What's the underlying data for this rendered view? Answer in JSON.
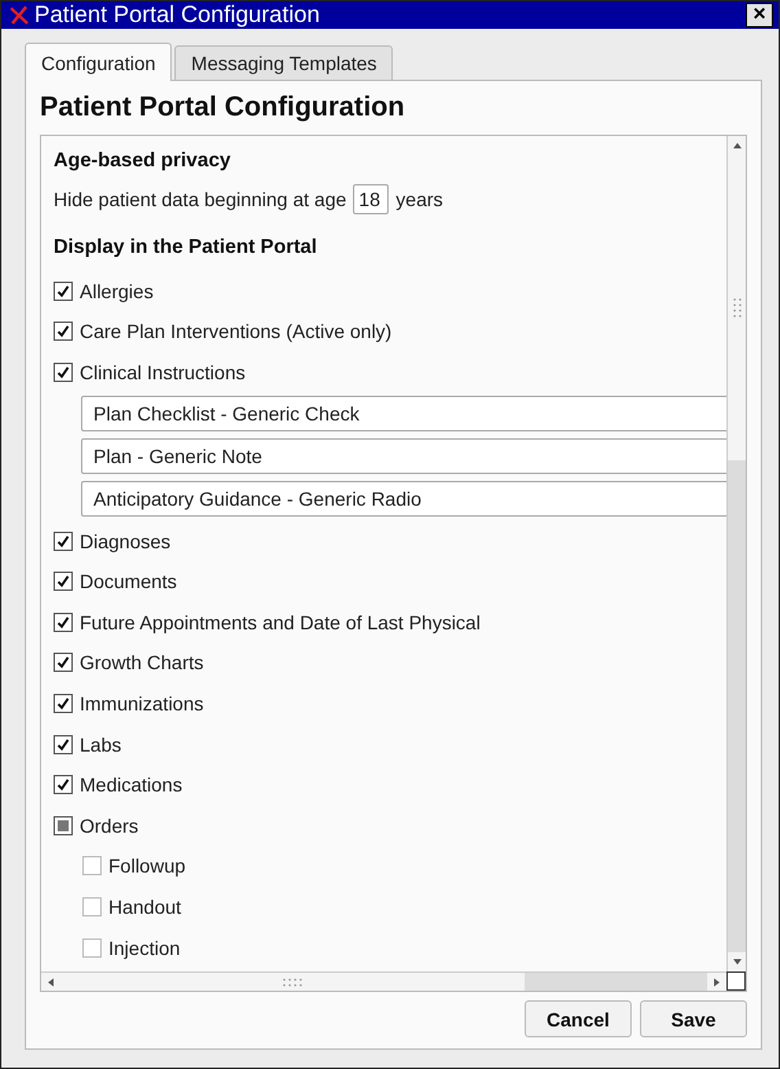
{
  "window": {
    "title": "Patient Portal Configuration",
    "close": "×"
  },
  "tabs": [
    {
      "label": "Configuration",
      "selected": true
    },
    {
      "label": "Messaging Templates",
      "selected": false
    }
  ],
  "heading": "Patient Portal Configuration",
  "privacy": {
    "title": "Age-based privacy",
    "label_before": "Hide patient data beginning at age",
    "age": "18",
    "label_after": "years"
  },
  "display": {
    "title": "Display in the Patient Portal",
    "items": [
      {
        "kind": "checkbox",
        "label": "Allergies",
        "checked": true,
        "mixed": false
      },
      {
        "kind": "checkbox",
        "label": "Care Plan Interventions (Active only)",
        "checked": true,
        "mixed": false
      },
      {
        "kind": "checkbox",
        "label": "Clinical Instructions",
        "checked": true,
        "mixed": false,
        "children": [
          {
            "kind": "field",
            "value": "Plan Checklist - Generic Check"
          },
          {
            "kind": "field",
            "value": "Plan - Generic Note"
          },
          {
            "kind": "field",
            "value": "Anticipatory Guidance - Generic Radio"
          }
        ]
      },
      {
        "kind": "checkbox",
        "label": "Diagnoses",
        "checked": true,
        "mixed": false
      },
      {
        "kind": "checkbox",
        "label": "Documents",
        "checked": true,
        "mixed": false
      },
      {
        "kind": "checkbox",
        "label": "Future Appointments and Date of Last Physical",
        "checked": true,
        "mixed": false
      },
      {
        "kind": "checkbox",
        "label": "Growth Charts",
        "checked": true,
        "mixed": false
      },
      {
        "kind": "checkbox",
        "label": "Immunizations",
        "checked": true,
        "mixed": false
      },
      {
        "kind": "checkbox",
        "label": "Labs",
        "checked": true,
        "mixed": false
      },
      {
        "kind": "checkbox",
        "label": "Medications",
        "checked": true,
        "mixed": false
      },
      {
        "kind": "checkbox",
        "label": "Orders",
        "checked": false,
        "mixed": true,
        "children": [
          {
            "kind": "checkbox",
            "label": "Followup",
            "checked": false,
            "mixed": false
          },
          {
            "kind": "checkbox",
            "label": "Handout",
            "checked": false,
            "mixed": false
          },
          {
            "kind": "checkbox",
            "label": "Injection",
            "checked": false,
            "mixed": false
          }
        ]
      }
    ]
  },
  "buttons": [
    {
      "label": "Cancel"
    },
    {
      "label": "Save"
    }
  ]
}
